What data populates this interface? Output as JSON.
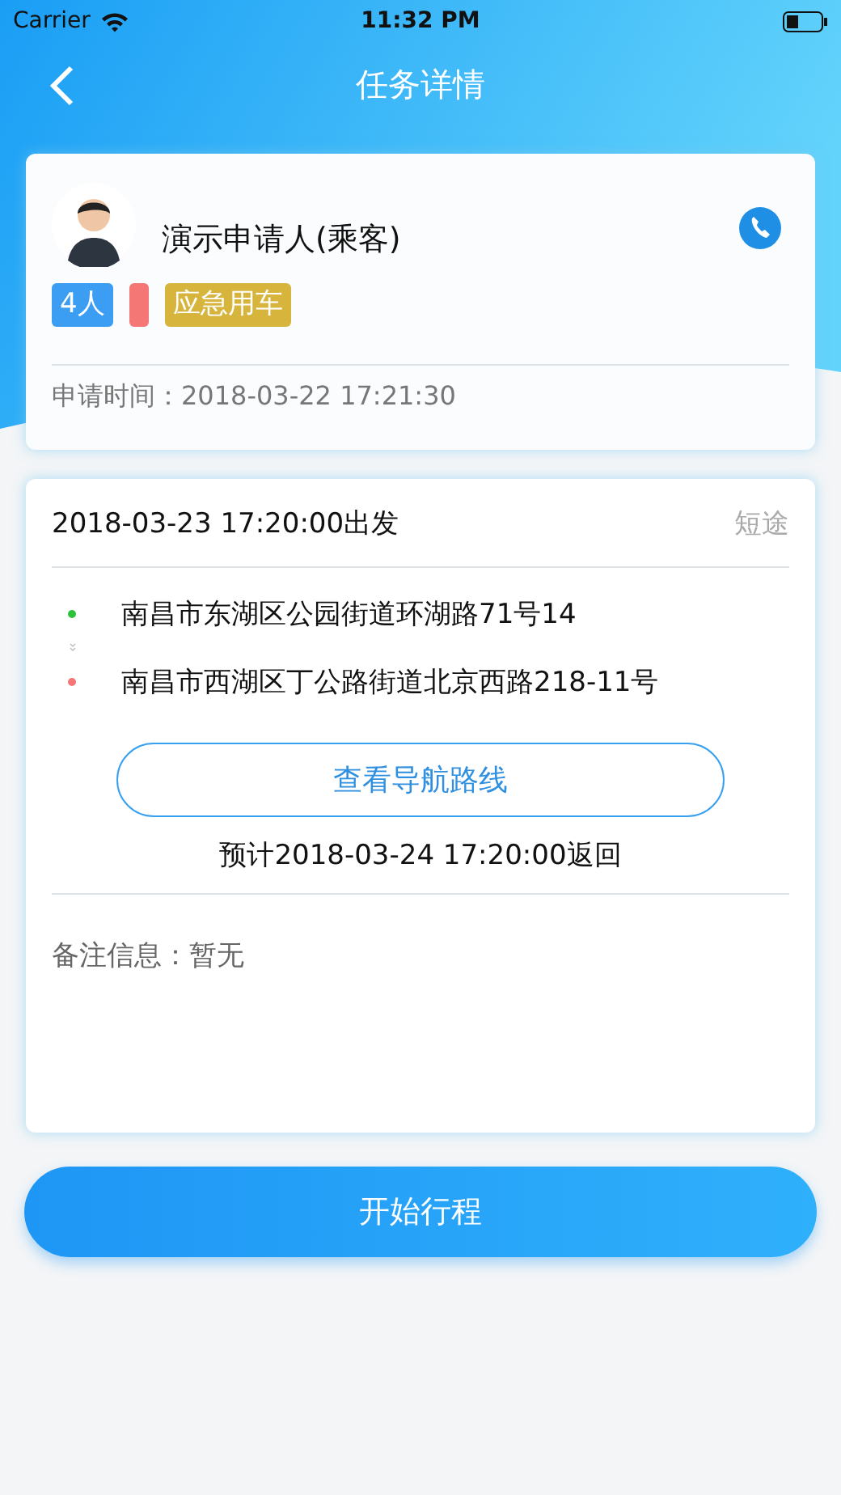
{
  "status_bar": {
    "carrier": "Carrier",
    "time": "11:32 PM"
  },
  "nav": {
    "title": "任务详情"
  },
  "applicant": {
    "name": "演示申请人(乘客)",
    "tags": [
      {
        "label": "4人",
        "color": "#3b9ef3"
      },
      {
        "color": "#f47776"
      },
      {
        "label": "应急用车",
        "color": "#d7b53c"
      }
    ],
    "time_label": "申请时间：",
    "time": "2018-03-22 17:21:30"
  },
  "trip": {
    "departure": "2018-03-23 17:20:00出发",
    "type": "短途",
    "stops": [
      {
        "address": "南昌市东湖区公园街道环湖路71号14",
        "color": "#2ec23a"
      },
      {
        "address": "南昌市西湖区丁公路街道北京西路218-11号",
        "color": "#f47776"
      }
    ],
    "route_button": "查看导航路线",
    "return": "预计2018-03-24 17:20:00返回",
    "note_label": "备注信息：",
    "note": "暂无"
  },
  "start_button": "开始行程"
}
